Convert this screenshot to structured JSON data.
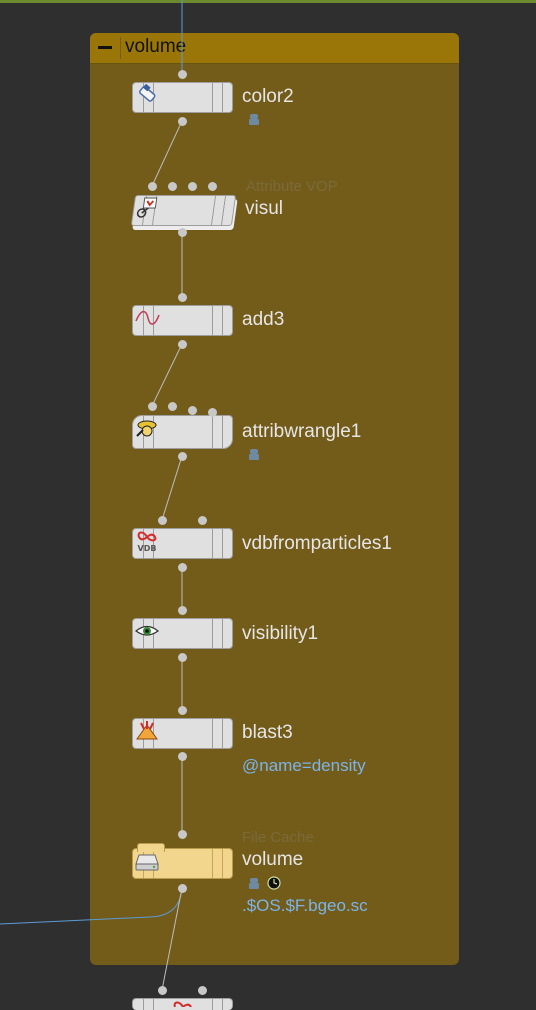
{
  "network_box": {
    "title": "volume"
  },
  "nodes": {
    "color2": {
      "name": "color2"
    },
    "visul": {
      "name": "visul",
      "type": "Attribute VOP"
    },
    "add3": {
      "name": "add3"
    },
    "attribwrangle1": {
      "name": "attribwrangle1"
    },
    "vdbfromparticles1": {
      "name": "vdbfromparticles1",
      "icon_text": "VDB"
    },
    "visibility1": {
      "name": "visibility1"
    },
    "blast3": {
      "name": "blast3",
      "info": "@name=density"
    },
    "volume": {
      "name": "volume",
      "type": "File Cache",
      "info": ".$OS.$F.bgeo.sc"
    }
  },
  "colors": {
    "background": "#2f2f2f",
    "network_box": "#735b1a",
    "network_box_header": "#9a7608",
    "node_body": "#e0e0e0",
    "file_cache_body": "#f2d68e",
    "info_text": "#7ab4e8",
    "wire": "#c8c8c8",
    "selected_wire": "#5b9bd5"
  }
}
